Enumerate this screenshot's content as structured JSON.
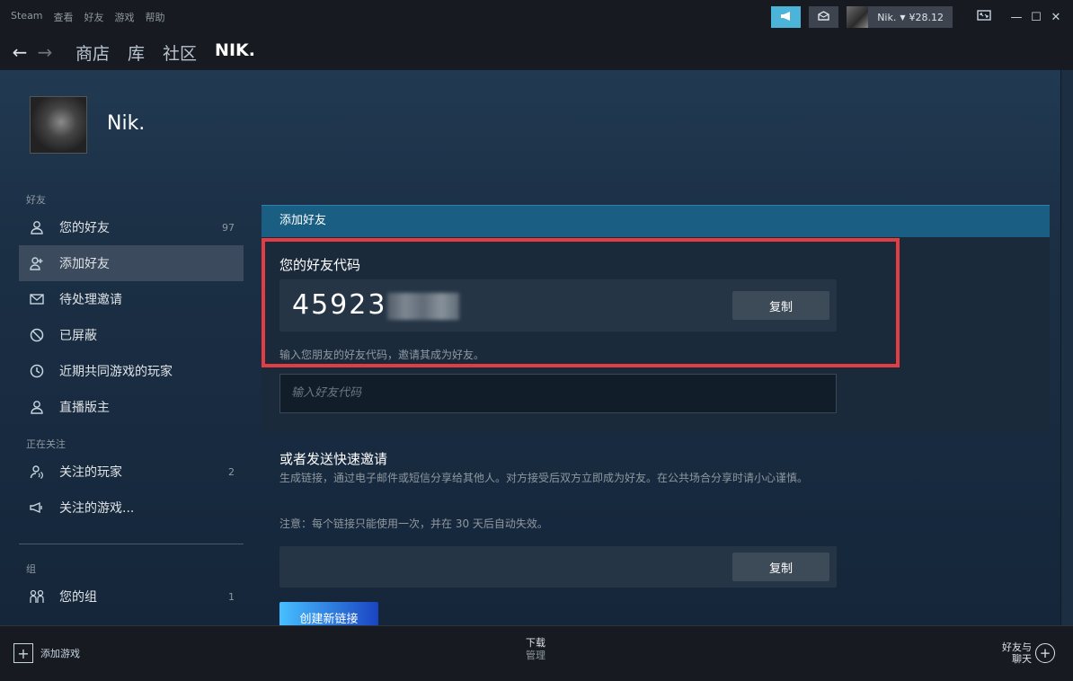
{
  "titlebar": {
    "menu": [
      "Steam",
      "查看",
      "好友",
      "游戏",
      "帮助"
    ],
    "user_name": "Nik.",
    "balance": "¥28.12"
  },
  "nav": {
    "tabs": [
      "商店",
      "库",
      "社区",
      "NIK."
    ]
  },
  "profile": {
    "name": "Nik."
  },
  "sidebar": {
    "friends_label": "好友",
    "items": [
      {
        "label": "您的好友",
        "count": "97"
      },
      {
        "label": "添加好友",
        "count": ""
      },
      {
        "label": "待处理邀请",
        "count": ""
      },
      {
        "label": "已屏蔽",
        "count": ""
      },
      {
        "label": "近期共同游戏的玩家",
        "count": ""
      },
      {
        "label": "直播版主",
        "count": ""
      }
    ],
    "following_label": "正在关注",
    "following_items": [
      {
        "label": "关注的玩家",
        "count": "2"
      },
      {
        "label": "关注的游戏...",
        "count": ""
      }
    ],
    "groups_label": "组",
    "group_items": [
      {
        "label": "您的组",
        "count": "1"
      }
    ]
  },
  "content": {
    "header": "添加好友",
    "code_title": "您的好友代码",
    "code_value": "45923",
    "copy_label": "复制",
    "hint": "输入您朋友的好友代码，邀请其成为好友。",
    "input_placeholder": "输入好友代码",
    "invite_title": "或者发送快速邀请",
    "invite_desc": "生成链接，通过电子邮件或短信分享给其他人。对方接受后双方立即成为好友。在公共场合分享时请小心谨慎。",
    "invite_note": "注意：每个链接只能使用一次，并在 30 天后自动失效。",
    "create_link_label": "创建新链接"
  },
  "footer": {
    "add_game": "添加游戏",
    "download": "下载",
    "manage": "管理",
    "friends_line1": "好友与",
    "friends_line2": "聊天"
  },
  "colors": {
    "highlight": "#e13d42",
    "header_bar": "#1a5f83",
    "accent": "#47bfff"
  }
}
